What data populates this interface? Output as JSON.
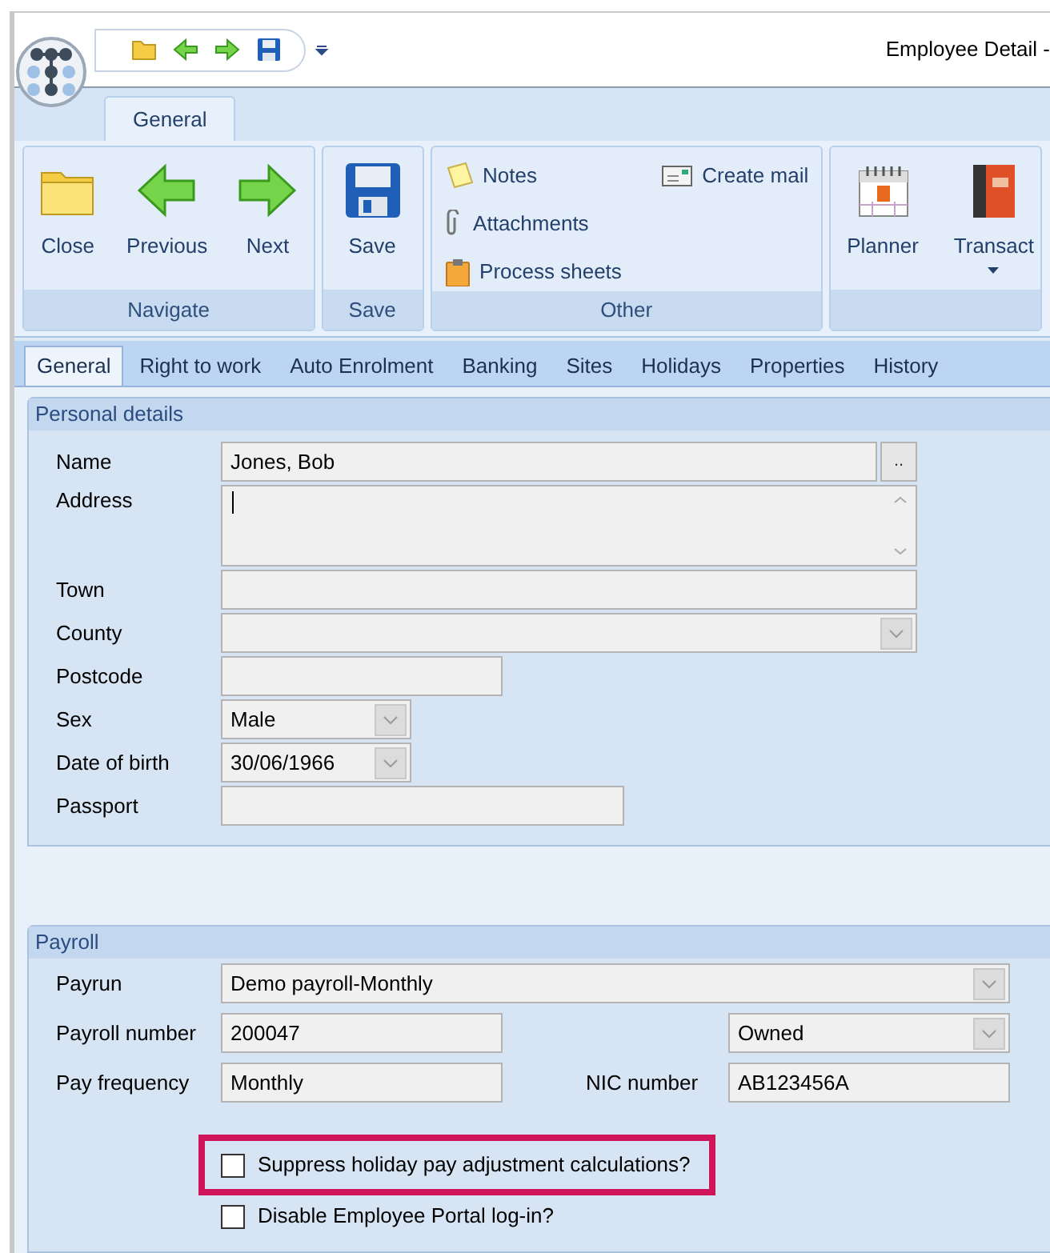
{
  "window": {
    "title": "Employee Detail -"
  },
  "ribbon": {
    "tabs": [
      {
        "label": "General",
        "selected": true
      }
    ],
    "groups": [
      {
        "label": "Navigate",
        "items": [
          "Close",
          "Previous",
          "Next"
        ]
      },
      {
        "label": "Save",
        "items": [
          "Save"
        ]
      },
      {
        "label": "Other",
        "items": [
          "Notes",
          "Attachments",
          "Process sheets",
          "Create mail"
        ]
      },
      {
        "items": [
          "Planner",
          "Transact"
        ]
      }
    ]
  },
  "tabs": [
    {
      "label": "General",
      "selected": true
    },
    {
      "label": "Right to work",
      "selected": false
    },
    {
      "label": "Auto Enrolment",
      "selected": false
    },
    {
      "label": "Banking",
      "selected": false
    },
    {
      "label": "Sites",
      "selected": false
    },
    {
      "label": "Holidays",
      "selected": false
    },
    {
      "label": "Properties",
      "selected": false
    },
    {
      "label": "History",
      "selected": false
    }
  ],
  "personal_details": {
    "title": "Personal details",
    "fields": [
      {
        "label": "Name",
        "value": "Jones, Bob",
        "button": ".."
      },
      {
        "label": "Address"
      },
      {
        "label": "Town"
      },
      {
        "label": "County"
      },
      {
        "label": "Postcode"
      },
      {
        "label": "Sex",
        "value": "Male"
      },
      {
        "label": "Date of birth",
        "value": "30/06/1966"
      },
      {
        "label": "Passport"
      }
    ]
  },
  "payroll": {
    "title": "Payroll",
    "payrun": {
      "label": "Payrun",
      "value": "Demo payroll-Monthly"
    },
    "payroll_number": {
      "label": "Payroll number",
      "value": "200047"
    },
    "ownership": {
      "value": "Owned"
    },
    "pay_frequency": {
      "label": "Pay frequency",
      "value": "Monthly"
    },
    "nic_number": {
      "label": "NIC number",
      "value": "AB123456A"
    },
    "checkboxes": [
      {
        "label": "Suppress holiday pay adjustment calculations?",
        "checked": false,
        "highlighted": true
      },
      {
        "label": "Disable Employee Portal log-in?",
        "checked": false,
        "highlighted": false
      }
    ]
  }
}
